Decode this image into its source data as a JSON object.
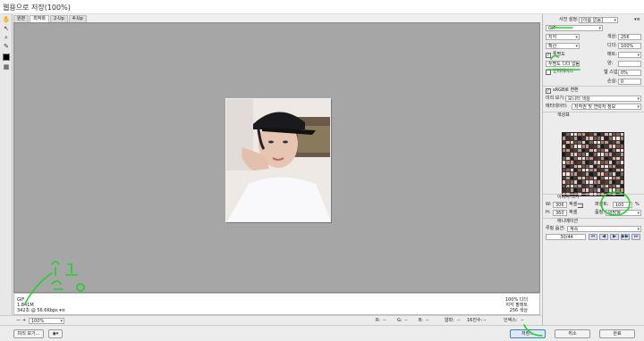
{
  "window": {
    "title": "웹용으로 저장(100%)"
  },
  "tabs": [
    {
      "label": "원본",
      "active": false
    },
    {
      "label": "최적화",
      "active": true
    },
    {
      "label": "2-Up",
      "active": false
    },
    {
      "label": "4-Up",
      "active": false
    }
  ],
  "info": {
    "format": "GIF",
    "size": "1.841M",
    "time": "342초 @ 56.6Kbps",
    "time_menu": "▾≡",
    "dither": "100% 디더",
    "palette": "지각 팔레트",
    "colors": "256 색상"
  },
  "bottombar": {
    "zoom": "100%",
    "r_label": "R:",
    "g_label": "G:",
    "b_label": "B:",
    "alpha_label": "알파:",
    "hex_label": "16진수:",
    "r_value": "--",
    "g_value": "--",
    "b_value": "--",
    "alpha_value": "--",
    "hex_value": "--",
    "index_label": "인덱스:",
    "index_value": "--"
  },
  "buttons": {
    "preview": "미리 보기...",
    "save": "저장...",
    "cancel": "취소",
    "done": "완료"
  },
  "settings": {
    "preset_label": "사전 설정:",
    "preset_value": "[이름 없음]",
    "format": "GIF",
    "reduction": "지각",
    "dither_algo": "확산",
    "colors_label": "색상:",
    "colors_value": "256",
    "dither_label": "디더:",
    "dither_value": "100%",
    "transparency_label": "투명도",
    "transparency_checked": true,
    "matte_label": "매트:",
    "matte_value": "",
    "transparency_dither": "투명도 디더 없음",
    "amount_label": "양:",
    "amount_value": "",
    "interlaced_label": "인터레이스",
    "interlaced_checked": false,
    "web_snap_label": "웹 스냅:",
    "web_snap_value": "0%",
    "lossy_label": "손실:",
    "lossy_value": "0",
    "srgb_label": "sRGB로 변환",
    "srgb_checked": true,
    "preview_label": "미리 보기:",
    "preview_value": "모니터 색상",
    "metadata_label": "메타데이터:",
    "metadata_value": "저작권 및 연락처 정보",
    "color_table_label": "색상표",
    "color_count": "256"
  },
  "image_size": {
    "section_label": "이미지 크기",
    "w_label": "W:",
    "w_value": "306",
    "h_label": "H:",
    "h_value": "360",
    "unit": "픽셀",
    "percent_label": "퍼센트:",
    "percent_value": "100",
    "percent_unit": "%",
    "quality_label": "품질:",
    "quality_value": "양방향"
  },
  "animation": {
    "section_label": "애니메이션",
    "loop_label": "루핑 옵션:",
    "loop_value": "계속",
    "frame": "30/44",
    "nav_first": "⏮",
    "nav_prev": "◀",
    "nav_play": "▶",
    "nav_next": "▶▶",
    "nav_last": "⏭"
  },
  "annotations": {
    "handwriting": "윤하윤"
  },
  "colors": {
    "annotation": "#1bd323",
    "canvas": "#a6a6a6",
    "accent": "#3c7fc1"
  }
}
